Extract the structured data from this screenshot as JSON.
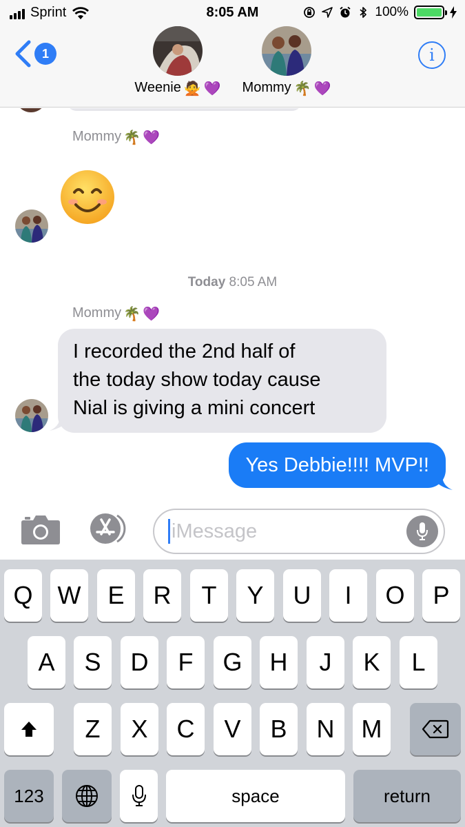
{
  "status_bar": {
    "carrier": "Sprint",
    "time": "8:05 AM",
    "battery_percent": "100%",
    "battery_level": 1.0,
    "icons": [
      "signal-bars-icon",
      "wifi-icon",
      "orientation-lock-icon",
      "location-arrow-icon",
      "alarm-icon",
      "bluetooth-icon",
      "battery-icon",
      "charging-bolt-icon"
    ]
  },
  "header": {
    "back_count": "1",
    "contacts": [
      {
        "name": "Weenie",
        "emojis": [
          "🙅",
          "💜"
        ]
      },
      {
        "name": "Mommy",
        "emojis": [
          "🌴",
          "💜"
        ]
      }
    ],
    "info_label": "i"
  },
  "messages": {
    "group1_sender": "Mommy",
    "group1_sender_emojis": [
      "🌴",
      "💜"
    ],
    "emoji_message": "smiling-face-emoji",
    "timestamp_day": "Today",
    "timestamp_time": "8:05 AM",
    "group2_sender": "Mommy",
    "group2_sender_emojis": [
      "🌴",
      "💜"
    ],
    "incoming_lines": [
      "I recorded the 2nd half of",
      "the today show today cause",
      "Nial is giving a mini concert"
    ],
    "outgoing": "Yes Debbie!!!! MVP!!"
  },
  "compose": {
    "placeholder": "iMessage",
    "value": ""
  },
  "keyboard": {
    "row1": [
      "Q",
      "W",
      "E",
      "R",
      "T",
      "Y",
      "U",
      "I",
      "O",
      "P"
    ],
    "row2": [
      "A",
      "S",
      "D",
      "F",
      "G",
      "H",
      "J",
      "K",
      "L"
    ],
    "row3": [
      "Z",
      "X",
      "C",
      "V",
      "B",
      "N",
      "M"
    ],
    "numbers_label": "123",
    "space_label": "space",
    "return_label": "return"
  },
  "colors": {
    "accent_blue": "#2f7df6",
    "outgoing_bubble": "#1a7cf6",
    "incoming_bubble": "#e6e6eb",
    "battery_green": "#4cd964",
    "keyboard_bg": "#d1d4d9"
  }
}
